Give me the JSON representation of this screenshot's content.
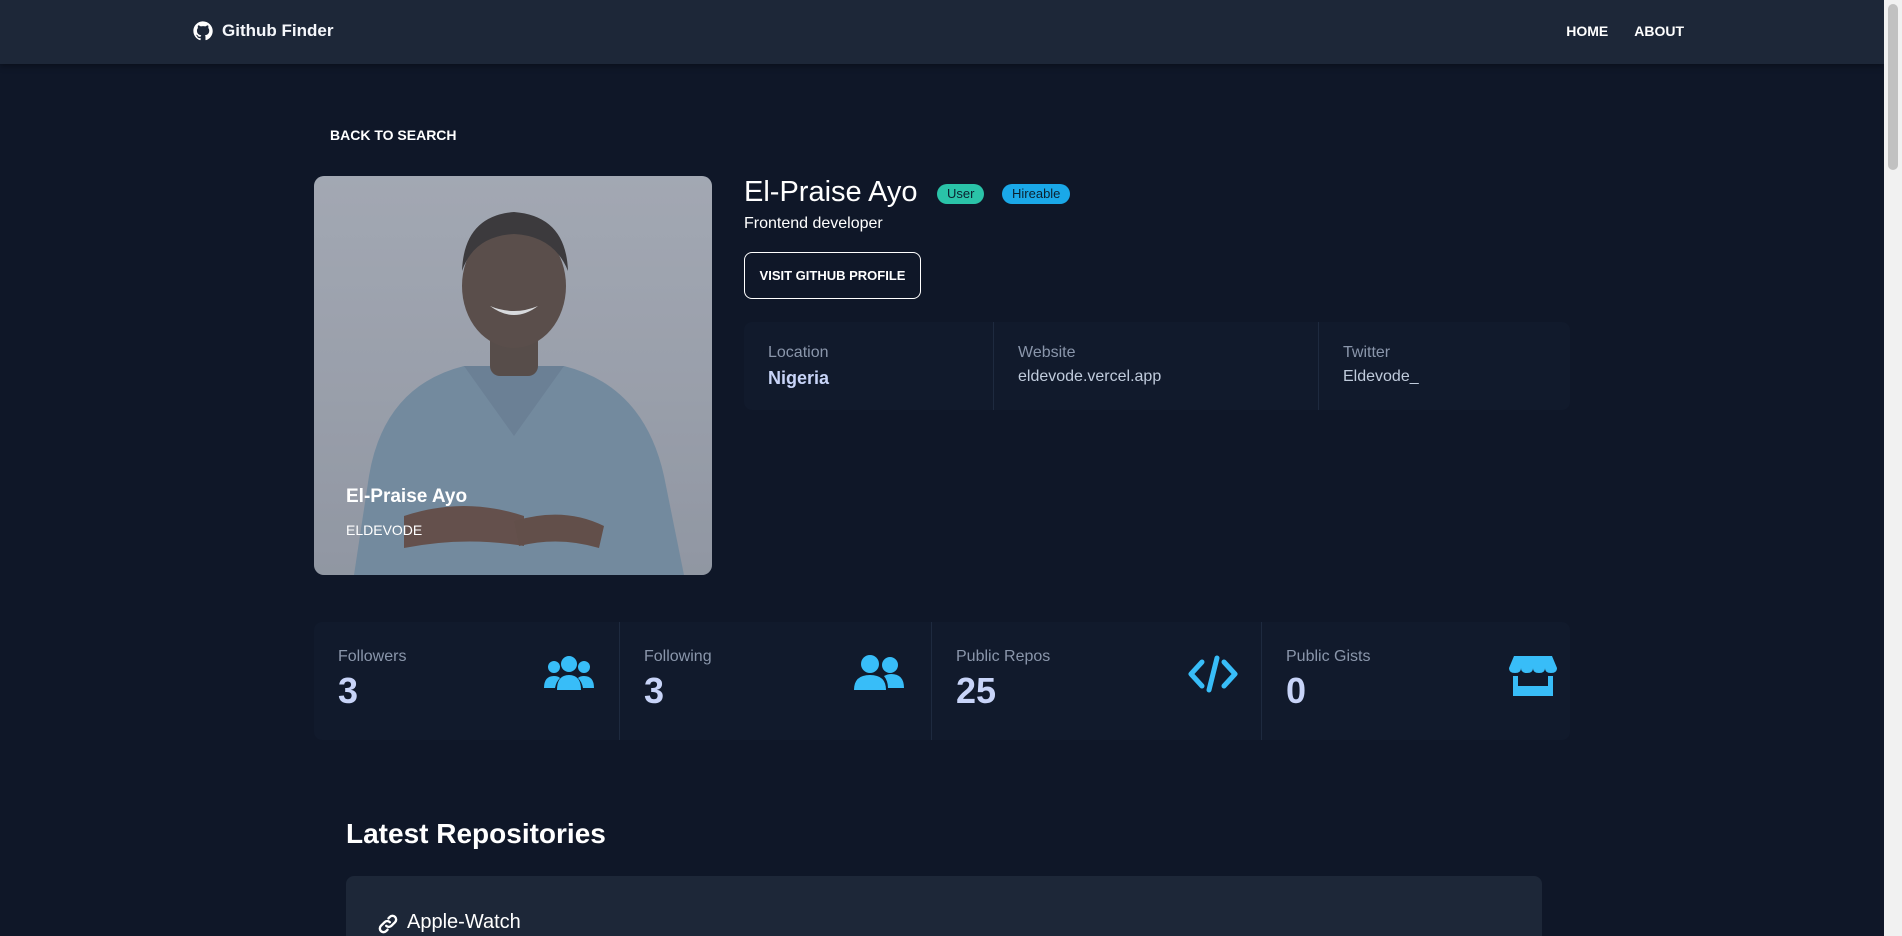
{
  "navbar": {
    "brand": "Github Finder",
    "links": [
      "HOME",
      "ABOUT"
    ]
  },
  "back_link": "BACK TO SEARCH",
  "avatar": {
    "name": "El-Praise Ayo",
    "login": "ELDEVODE"
  },
  "profile": {
    "name": "El-Praise Ayo",
    "badges": [
      "User",
      "Hireable"
    ],
    "bio": "Frontend developer",
    "visit_label": "VISIT GITHUB PROFILE"
  },
  "info": [
    {
      "label": "Location",
      "value": "Nigeria"
    },
    {
      "label": "Website",
      "value": "eldevode.vercel.app"
    },
    {
      "label": "Twitter",
      "value": "Eldevode_"
    }
  ],
  "stats": [
    {
      "label": "Followers",
      "value": "3",
      "icon": "users-icon"
    },
    {
      "label": "Following",
      "value": "3",
      "icon": "user-friends-icon"
    },
    {
      "label": "Public Repos",
      "value": "25",
      "icon": "code-icon"
    },
    {
      "label": "Public Gists",
      "value": "0",
      "icon": "store-icon"
    }
  ],
  "repos": {
    "title": "Latest Repositories",
    "items": [
      {
        "name": "Apple-Watch"
      }
    ]
  },
  "colors": {
    "background": "#0f1728",
    "navbar": "#1d2738",
    "accent_icon": "#38bdf8",
    "badge_user": "#2ac3a8",
    "badge_hireable": "#1aa8e8",
    "stat_value": "#c8d4f8"
  }
}
